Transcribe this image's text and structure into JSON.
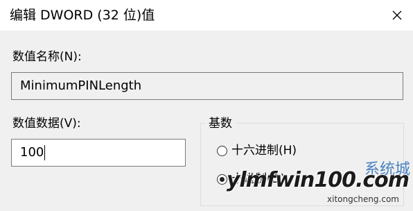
{
  "dialog": {
    "title": "编辑 DWORD (32 位)值",
    "close_icon": "close-icon"
  },
  "value_name": {
    "label": "数值名称(N):",
    "value": "MinimumPINLength"
  },
  "value_data": {
    "label": "数值数据(V):",
    "value": "100"
  },
  "base": {
    "legend": "基数",
    "options": [
      {
        "label": "十六进制(H)",
        "checked": false
      },
      {
        "label": "十进制(D)",
        "checked": true
      }
    ]
  },
  "watermark": {
    "logo": "系统城",
    "main": "ylmfwin100.com",
    "sub": "xitongcheng.com"
  }
}
